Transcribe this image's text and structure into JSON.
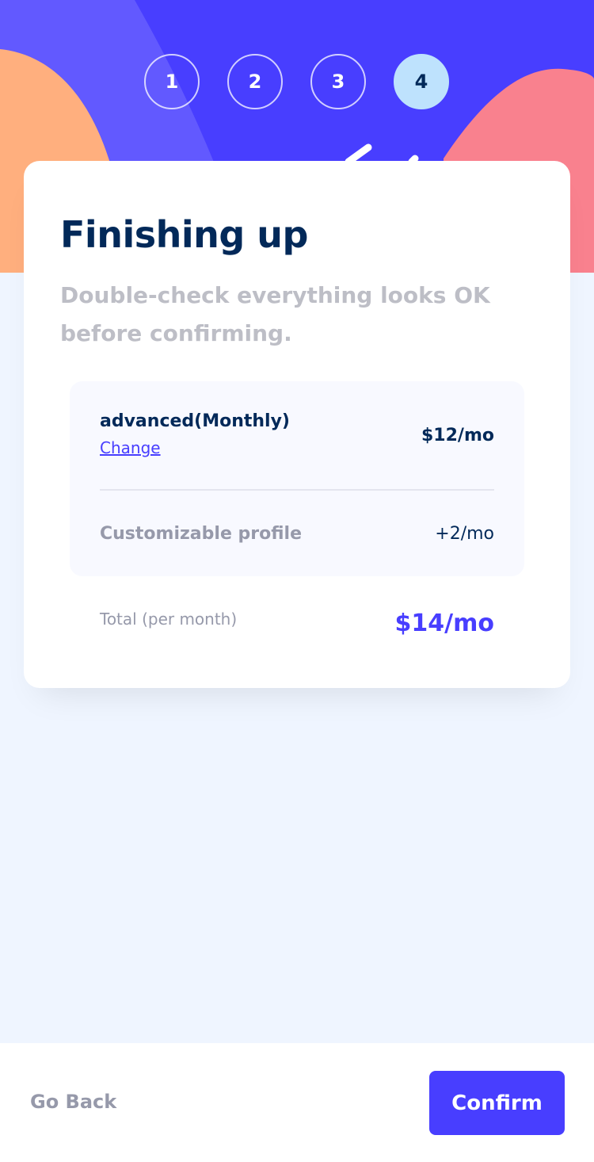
{
  "steps": [
    {
      "label": "1"
    },
    {
      "label": "2"
    },
    {
      "label": "3"
    },
    {
      "label": "4"
    }
  ],
  "active_step": "4",
  "main": {
    "title": "Finishing up",
    "subtitle": "Double-check everything looks OK before confirming."
  },
  "summary": {
    "plan_name": "advanced(Monthly)",
    "change_label": "Change",
    "plan_price": "$12/mo",
    "addons": [
      {
        "name": "Customizable profile",
        "price": "+2/mo"
      }
    ],
    "total_label": "Total (per month)",
    "total_price": "$14/mo"
  },
  "footer": {
    "back_label": "Go Back",
    "confirm_label": "Confirm"
  },
  "colors": {
    "primary": "#483eff",
    "hero_light": "#6259ff",
    "blob_orange": "#ffaf7e",
    "blob_pink": "#f9818e",
    "denim": "#022959",
    "grey": "#9699aa",
    "light_grey": "#bdbec6",
    "page_bg": "#eff5ff",
    "active_step_bg": "#bee2fd"
  }
}
